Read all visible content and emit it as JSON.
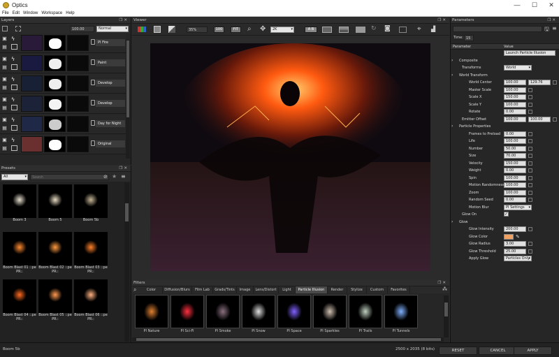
{
  "window": {
    "title": "Optics",
    "min": "—",
    "max": "☐",
    "close": "✕"
  },
  "menu": [
    "File",
    "Edit",
    "Window",
    "Workspace",
    "Help"
  ],
  "layers": {
    "header": "Layers",
    "opacity": "100.00",
    "blend_mode": "Normal",
    "rows": [
      {
        "name": "PI Fire",
        "thumb_color": "#2a1a3a",
        "mask": "#fff"
      },
      {
        "name": "Paint",
        "thumb_color": "#1a1a40",
        "mask": "#eee"
      },
      {
        "name": "Develop",
        "thumb_color": "#182036",
        "mask": "#eee"
      },
      {
        "name": "Develop",
        "thumb_color": "#1c2238",
        "mask": "#f4f4f4"
      },
      {
        "name": "Day for Night",
        "thumb_color": "#202848",
        "mask": "#ccc"
      },
      {
        "name": "Original",
        "thumb_color": "#6a3030",
        "mask": "#ffffff"
      }
    ]
  },
  "presets": {
    "header": "Presets",
    "category": "All",
    "search_placeholder": "Search",
    "items": [
      {
        "label": "Boom 3",
        "color": "#e8e0d0"
      },
      {
        "label": "Boom 5",
        "color": "#e8dcc4"
      },
      {
        "label": "Boom 5b",
        "color": "#c8b898"
      },
      {
        "label": "Boom Blast 01 ::pe PR::",
        "color": "#ff8a30"
      },
      {
        "label": "Boom Blast 02 ::pe PR::",
        "color": "#ff9a40"
      },
      {
        "label": "Boom Blast 03 ::pe PR::",
        "color": "#ff8028"
      },
      {
        "label": "Boom Blast 04 ::pe PR::",
        "color": "#ff6a20"
      },
      {
        "label": "Boom Blast 05 ::pe PR::",
        "color": "#ff9a50"
      },
      {
        "label": "Boom Blast 06 ::pe PR::",
        "color": "#ffb080"
      }
    ]
  },
  "viewer": {
    "header": "Viewer",
    "zoom": "35%",
    "btn_100": "100",
    "btn_fit": "FIT",
    "res": "2K",
    "ab": "A B"
  },
  "filters": {
    "header": "Filters",
    "tabs": [
      "Color",
      "Diffusion/Blurs",
      "Film Lab",
      "Grads/Tints",
      "Image",
      "Lens/Distort",
      "Light",
      "Particle Illusion",
      "Render",
      "Stylize",
      "Custom",
      "Favorites"
    ],
    "active_tab": "Particle Illusion",
    "items": [
      {
        "label": "PI Nature",
        "color": "#e08030"
      },
      {
        "label": "PI Sci-Fi",
        "color": "#ff3040"
      },
      {
        "label": "PI Smoke",
        "color": "#8a7080"
      },
      {
        "label": "PI Snow",
        "color": "#e0e0e0"
      },
      {
        "label": "PI Space",
        "color": "#8060ff"
      },
      {
        "label": "PI Sparkles",
        "color": "#d0c0b0"
      },
      {
        "label": "PI Trails",
        "color": "#c0d0c0"
      },
      {
        "label": "PI Tunnels",
        "color": "#80b0ff"
      }
    ]
  },
  "parameters": {
    "header": "Parameters",
    "time_label": "Time:",
    "time_value": "15",
    "col_param": "Parameter",
    "col_value": "Value",
    "launch_btn": "Launch Particle Illusion",
    "rows": {
      "composite": "Composite",
      "transforms": "Transforms",
      "transforms_val": "World",
      "world_transform": "World Transform",
      "world_center": "World Center",
      "world_center_x": "100.00",
      "world_center_y": "129.76",
      "master_scale": "Master Scale",
      "master_scale_v": "100.00",
      "scale_x": "Scale X",
      "scale_x_v": "150.00",
      "scale_y": "Scale Y",
      "scale_y_v": "100.00",
      "rotate": "Rotate",
      "rotate_v": "0.00",
      "emitter_offset": "Emitter Offset",
      "emitter_offset_x": "100.00",
      "emitter_offset_y": "100.00",
      "particle_props": "Particle Properties",
      "frames_preload": "Frames to Preload",
      "frames_preload_v": "0.00",
      "life": "Life",
      "life_v": "100.00",
      "number": "Number",
      "number_v": "50.00",
      "size": "Size",
      "size_v": "70.00",
      "velocity": "Velocity",
      "velocity_v": "150.00",
      "weight": "Weight",
      "weight_v": "0.00",
      "spin": "Spin",
      "spin_v": "100.00",
      "motion_random": "Motion Randomness",
      "motion_random_v": "100.00",
      "zoom": "Zoom",
      "zoom_v": "100.00",
      "random_seed": "Random Seed",
      "random_seed_v": "0.00",
      "motion_blur": "Motion Blur",
      "motion_blur_v": "PI Settings",
      "glow_on": "Glow On",
      "glow": "Glow",
      "glow_intensity": "Glow Intensity",
      "glow_intensity_v": "200.00",
      "glow_color": "Glow Color",
      "glow_radius": "Glow Radius",
      "glow_radius_v": "3.00",
      "glow_threshold": "Glow Threshold",
      "glow_threshold_v": "25.00",
      "apply_glow": "Apply Glow",
      "apply_glow_v": "Particles Only"
    },
    "glow_color_hex": "#f0a060"
  },
  "status": {
    "preset_name": "Boom 5b",
    "dimensions": "2500 x 2035 (8 bits)",
    "reset": "RESET",
    "cancel": "CANCEL",
    "apply": "APPLY"
  }
}
